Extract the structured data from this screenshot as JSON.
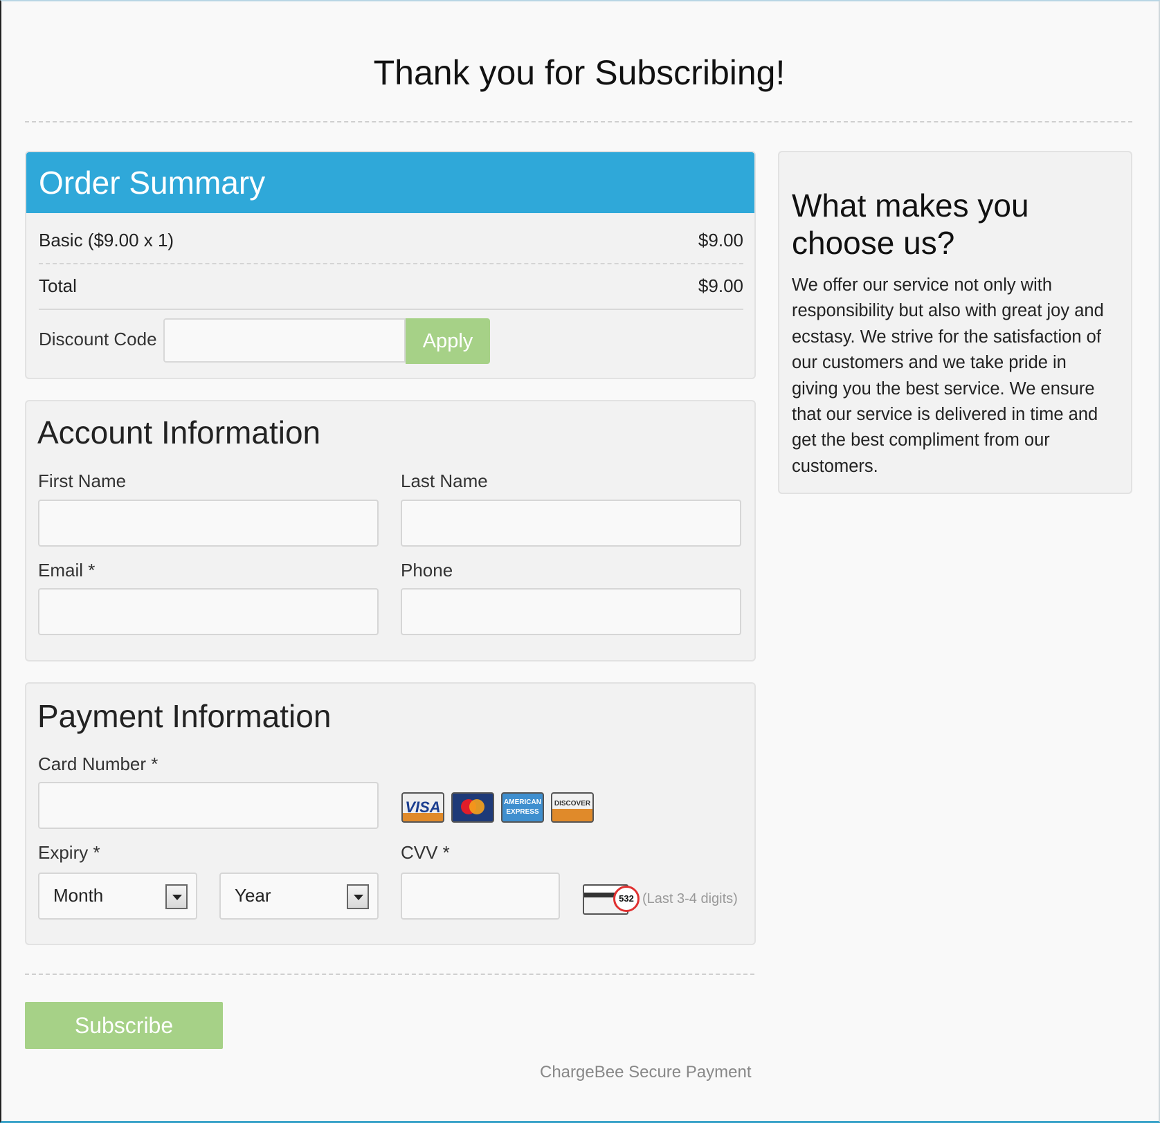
{
  "page": {
    "title": "Thank you for Subscribing!"
  },
  "order": {
    "heading": "Order Summary",
    "items": [
      {
        "label": "Basic ($9.00 x 1)",
        "amount": "$9.00"
      }
    ],
    "total_label": "Total",
    "total_amount": "$9.00",
    "discount": {
      "label": "Discount Code",
      "value": "",
      "placeholder": "",
      "button": "Apply"
    }
  },
  "account": {
    "heading": "Account Information",
    "fields": {
      "first_name": {
        "label": "First Name",
        "value": ""
      },
      "last_name": {
        "label": "Last Name",
        "value": ""
      },
      "email": {
        "label": "Email *",
        "value": ""
      },
      "phone": {
        "label": "Phone",
        "value": ""
      }
    }
  },
  "payment": {
    "heading": "Payment Information",
    "card_number": {
      "label": "Card Number *",
      "value": ""
    },
    "card_logos": [
      "VISA",
      "MasterCard",
      "AMERICAN EXPRESS",
      "DISCOVER"
    ],
    "expiry": {
      "label": "Expiry *",
      "month": "Month",
      "year": "Year"
    },
    "cvv": {
      "label": "CVV *",
      "value": "",
      "sample_digits": "532",
      "hint": "(Last 3-4 digits)"
    }
  },
  "sidebar": {
    "heading": "What makes you choose us?",
    "body": "We offer our service not only with responsibility but also with great joy and ecstasy. We strive for the satisfaction of our customers and we take pride in giving you the best service. We ensure that our service is delivered in time and get the best compliment from our customers."
  },
  "actions": {
    "subscribe": "Subscribe"
  },
  "footer": {
    "note": "ChargeBee Secure Payment"
  },
  "colors": {
    "header_blue": "#2fa8d9",
    "button_green": "#a6d187",
    "panel_bg": "#f2f2f2"
  },
  "icons": [
    "visa-card-icon",
    "mastercard-icon",
    "amex-card-icon",
    "discover-card-icon",
    "cvv-card-icon",
    "select-arrow-icon"
  ]
}
